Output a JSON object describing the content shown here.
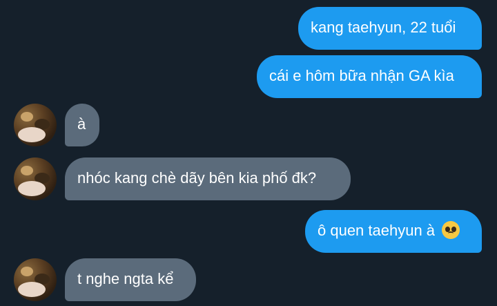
{
  "messages": [
    {
      "dir": "sent",
      "text": "kang taehyun, 22 tuổi"
    },
    {
      "dir": "sent",
      "text": "cái e hôm bữa nhận GA kìa"
    },
    {
      "dir": "received",
      "text": "à"
    },
    {
      "dir": "received",
      "text": "nhóc kang chè dãy bên kia phố đk?"
    },
    {
      "dir": "sent",
      "text": "ô quen taehyun à",
      "emoji": "pleading-face-emoji"
    },
    {
      "dir": "received",
      "text": "t nghe ngta kể"
    }
  ],
  "colors": {
    "background": "#15202b",
    "sent_bubble": "#1d9bf0",
    "received_bubble": "#5b6b7b",
    "text": "#ffffff"
  }
}
